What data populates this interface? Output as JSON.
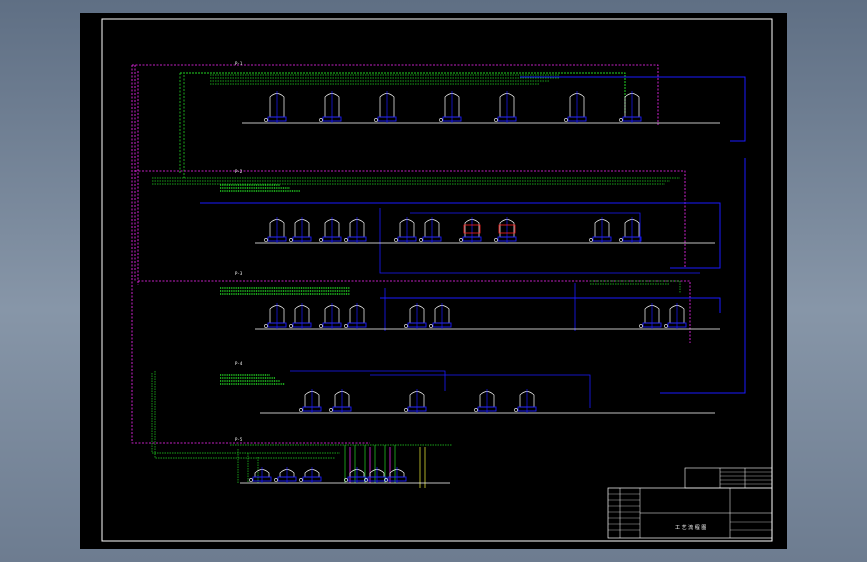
{
  "drawing": {
    "line_colors": {
      "frame": "#ffffff",
      "pipe_blue": "#1a1aff",
      "pipe_green": "#22d422",
      "pipe_magenta": "#ff2bff",
      "pipe_yellow": "#f2f23a",
      "equipment": "#ffffff",
      "highlight_red": "#ff2020"
    },
    "title_block": {
      "drawing_title": "工 艺 流 程 图"
    },
    "sections": [
      {
        "id": "s1",
        "tanks": 7
      },
      {
        "id": "s2",
        "tanks": 10
      },
      {
        "id": "s3",
        "tanks": 8
      },
      {
        "id": "s4",
        "tanks": 5
      },
      {
        "id": "s5",
        "tanks": 6
      }
    ]
  }
}
